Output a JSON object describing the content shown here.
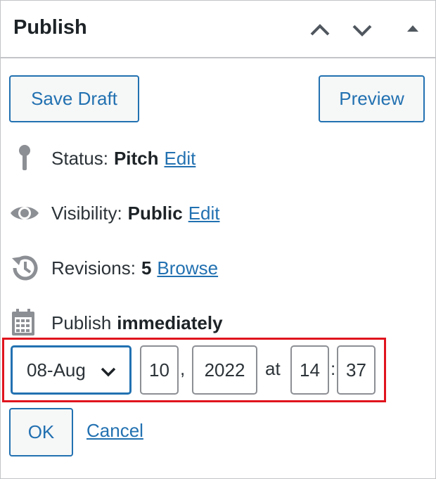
{
  "header": {
    "title": "Publish"
  },
  "buttons": {
    "save_draft": "Save Draft",
    "preview": "Preview"
  },
  "status": {
    "label": "Status:",
    "value": "Pitch",
    "link": "Edit"
  },
  "visibility": {
    "label": "Visibility:",
    "value": "Public",
    "link": "Edit"
  },
  "revisions": {
    "label": "Revisions:",
    "value": "5",
    "link": "Browse"
  },
  "publish": {
    "label": "Publish",
    "value": "immediately"
  },
  "date": {
    "month": "08-Aug",
    "day": "10",
    "comma": ",",
    "year": "2022",
    "at": "at",
    "hour": "14",
    "colon": ":",
    "minute": "37"
  },
  "actions": {
    "ok": "OK",
    "cancel": "Cancel"
  },
  "colors": {
    "accent": "#2271b1",
    "highlight": "#e0141e",
    "text": "#1d2327"
  }
}
